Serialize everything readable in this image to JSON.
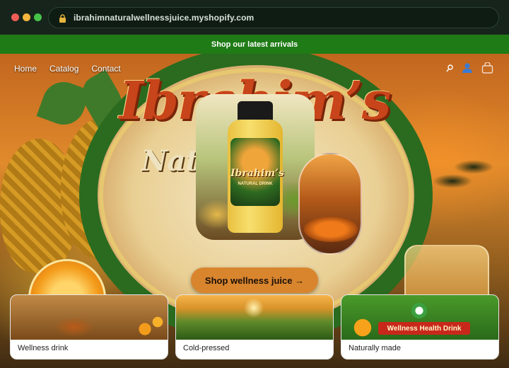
{
  "browser": {
    "url": "ibrahimnaturalwellnessjuice.myshopify.com"
  },
  "announcement": {
    "text": "Shop our latest arrivals"
  },
  "nav": {
    "items": [
      "Home",
      "Catalog",
      "Contact"
    ],
    "icons": [
      "search-icon",
      "account-icon",
      "cart-icon"
    ]
  },
  "hero": {
    "brand_word": "Ibrahim’s",
    "brand_sub": "Nat",
    "bottle_label": "Ibrahim’s",
    "bottle_sub": "NATURAL DRINK",
    "cta_label": "Shop wellness juice →"
  },
  "cards": [
    {
      "caption": "Wellness drink"
    },
    {
      "caption": "Cold-pressed"
    },
    {
      "caption": "Naturally made",
      "banner": "Wellness Health Drink"
    }
  ],
  "colors": {
    "announcement_bg": "#1f7b16",
    "cta_bg": "#d9852e",
    "brand_red": "#c8441a"
  }
}
